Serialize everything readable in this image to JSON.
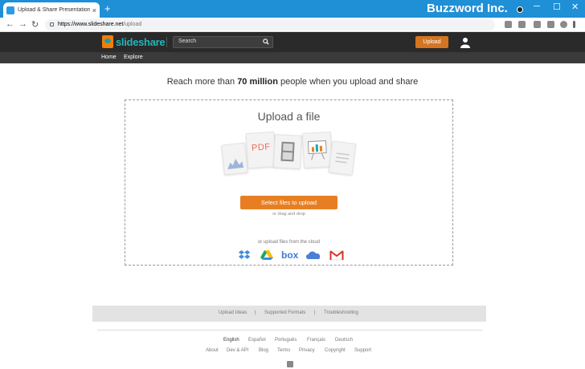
{
  "browser": {
    "tab_title": "Upload & Share Presentations, In",
    "tab_close": "×",
    "new_tab": "+",
    "brand": "Buzzword Inc.",
    "window_min": "─",
    "window_max": "☐",
    "window_close": "✕",
    "back": "←",
    "forward": "→",
    "reload": "↻",
    "url_host": "https://www.slideshare.net",
    "url_path": "/upload"
  },
  "header": {
    "logo_text": "slideshare",
    "search_placeholder": "Search",
    "upload_label": "Upload",
    "nav_home": "Home",
    "nav_explore": "Explore"
  },
  "main": {
    "headline_pre": "Reach more than ",
    "headline_bold": "70 million",
    "headline_post": " people when you upload and share",
    "upload_title": "Upload a file",
    "pdf_label": "PDF",
    "select_button": "Select files to upload",
    "drag_text": "or drag and drop",
    "cloud_text": "or upload files from the cloud",
    "cloud_services": [
      "dropbox-icon",
      "google-drive-icon",
      "box-icon",
      "onedrive-icon",
      "gmail-icon"
    ],
    "box_label": "box"
  },
  "footer": {
    "bar_links": [
      "Upload Ideas",
      "|",
      "Supported Formats",
      "|",
      "Troubleshooting"
    ],
    "languages": [
      "English",
      "Español",
      "Português",
      "Français",
      "Deutsch"
    ],
    "links": [
      "About",
      "Dev & API",
      "Blog",
      "Terms",
      "Privacy",
      "Copyright",
      "Support"
    ]
  },
  "colors": {
    "titlebar": "#1f8fd6",
    "header_bg": "#2a2a2a",
    "accent_orange": "#e77f22",
    "logo_teal": "#21b5b8"
  }
}
